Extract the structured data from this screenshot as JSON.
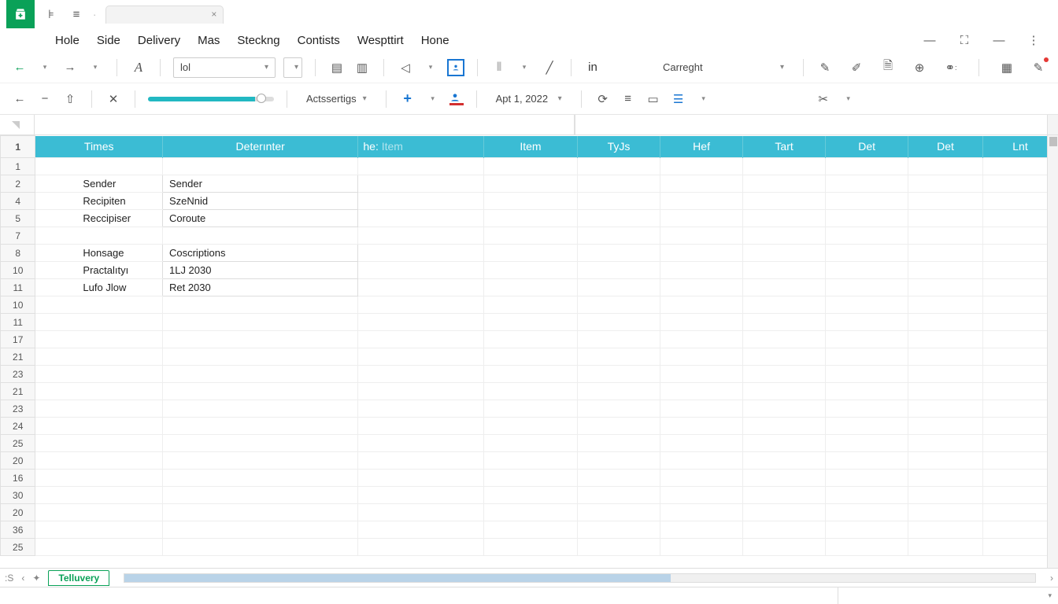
{
  "titlebar": {
    "tab_label": "",
    "close_glyph": "×"
  },
  "menu": {
    "items": [
      "Hole",
      "Side",
      "Delivery",
      "Mas",
      "Steckng",
      "Contists",
      "Wespttirt",
      "Hone"
    ]
  },
  "toolbar1": {
    "font_select": "lol",
    "in_label": "in",
    "style_select": "Carreght"
  },
  "toolbar2": {
    "action_select": "Actssertigs",
    "date_select": "Apt 1, 2022"
  },
  "formula": {
    "namebox_marker": ""
  },
  "headers": {
    "row_marker": "1",
    "times": "Times",
    "deterinter": "Deterınter",
    "he_prefix": "he:",
    "he_item": "Item",
    "item": "Item",
    "tyjs": "TyJs",
    "hef": "Hef",
    "tart": "Tart",
    "det1": "Det",
    "det2": "Det",
    "lnt": "Lnt"
  },
  "row_labels": [
    "1",
    "2",
    "4",
    "5",
    "7",
    "8",
    "10",
    "11",
    "10",
    "11",
    "17",
    "21",
    "23",
    "21",
    "23",
    "24",
    "25",
    "20",
    "16",
    "30",
    "20",
    "36",
    "25"
  ],
  "cells": {
    "r2a": "Sender",
    "r2b": "Sender",
    "r3a": "Recipiten",
    "r3b": "SzeNnid",
    "r4a": "Reccipiser",
    "r4b": "Coroute",
    "r6a": "Honsage",
    "r6b": "Coscriptions",
    "r7a": "Practalıtyı",
    "r7b": "1LJ 2030",
    "r8a": "Lufo Jlow",
    "r8b": "Ret 2030"
  },
  "sheet_tab": "Telluvery",
  "footer_nav": {
    "first": ":S",
    "prev": "‹",
    "add": "✦",
    "next": "›"
  }
}
